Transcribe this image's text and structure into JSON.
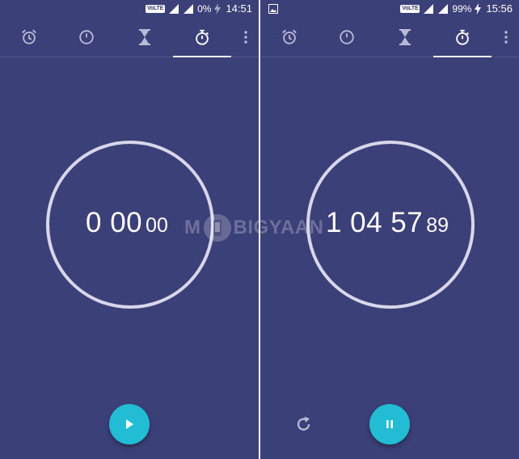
{
  "left": {
    "status": {
      "battery": "0%",
      "time": "14:51",
      "volte": "VoLTE"
    },
    "timer": {
      "main": "0 00",
      "centis": "00"
    },
    "tabs": [
      "alarm-icon",
      "clock-icon",
      "timer-icon",
      "stopwatch-icon"
    ],
    "fab": "play-icon"
  },
  "right": {
    "status": {
      "battery": "99%",
      "time": "15:56",
      "volte": "VoLTE"
    },
    "timer": {
      "main": "1 04 57",
      "centis": "89"
    },
    "tabs": [
      "alarm-icon",
      "clock-icon",
      "timer-icon",
      "stopwatch-icon"
    ],
    "fab": "pause-icon",
    "reset": "reset-icon"
  },
  "watermark": {
    "before": "M",
    "after": "BIGYAAN"
  },
  "colors": {
    "background": "#3c4078",
    "accent": "#22bcd4",
    "ring": "#d7d6ea",
    "icon": "#b9bad6"
  }
}
